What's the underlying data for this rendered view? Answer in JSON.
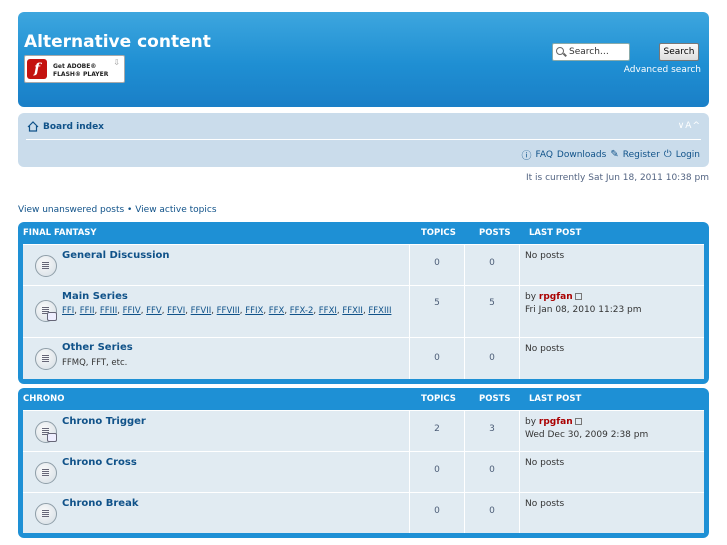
{
  "header": {
    "site_title": "Alternative content",
    "flash_badge": {
      "line1": "Get ADOBE®",
      "line2": "FLASH® PLAYER"
    },
    "search_placeholder": "Search…",
    "search_button": "Search",
    "advanced_search": "Advanced search"
  },
  "nav": {
    "board_index": "Board index",
    "resize": "∨A^",
    "faq": "FAQ",
    "downloads": "Downloads",
    "register": "Register",
    "login": "Login"
  },
  "current_time": "It is currently Sat Jun 18, 2011 10:38 pm",
  "quick_links": {
    "unanswered": "View unanswered posts",
    "separator": " • ",
    "active": "View active topics"
  },
  "categories": [
    {
      "name": "FINAL FANTASY",
      "col_topics": "TOPICS",
      "col_posts": "POSTS",
      "col_last": "LAST POST",
      "forums": [
        {
          "title": "General Discussion",
          "topics": "0",
          "posts": "0",
          "last_none": "No posts"
        },
        {
          "title": "Main Series",
          "subforums": [
            "FFI",
            "FFII",
            "FFIII",
            "FFIV",
            "FFV",
            "FFVI",
            "FFVII",
            "FFVIII",
            "FFIX",
            "FFX",
            "FFX-2",
            "FFXI",
            "FFXII",
            "FFXIII"
          ],
          "topics": "5",
          "posts": "5",
          "last_by": "by ",
          "last_author": "rpgfan",
          "last_date": "Fri Jan 08, 2010 11:23 pm"
        },
        {
          "title": "Other Series",
          "desc": "FFMQ, FFT, etc.",
          "topics": "0",
          "posts": "0",
          "last_none": "No posts"
        }
      ]
    },
    {
      "name": "CHRONO",
      "col_topics": "TOPICS",
      "col_posts": "POSTS",
      "col_last": "LAST POST",
      "forums": [
        {
          "title": "Chrono Trigger",
          "topics": "2",
          "posts": "3",
          "last_by": "by ",
          "last_author": "rpgfan",
          "last_date": "Wed Dec 30, 2009 2:38 pm"
        },
        {
          "title": "Chrono Cross",
          "topics": "0",
          "posts": "0",
          "last_none": "No posts"
        },
        {
          "title": "Chrono Break",
          "topics": "0",
          "posts": "0",
          "last_none": "No posts"
        }
      ]
    }
  ]
}
